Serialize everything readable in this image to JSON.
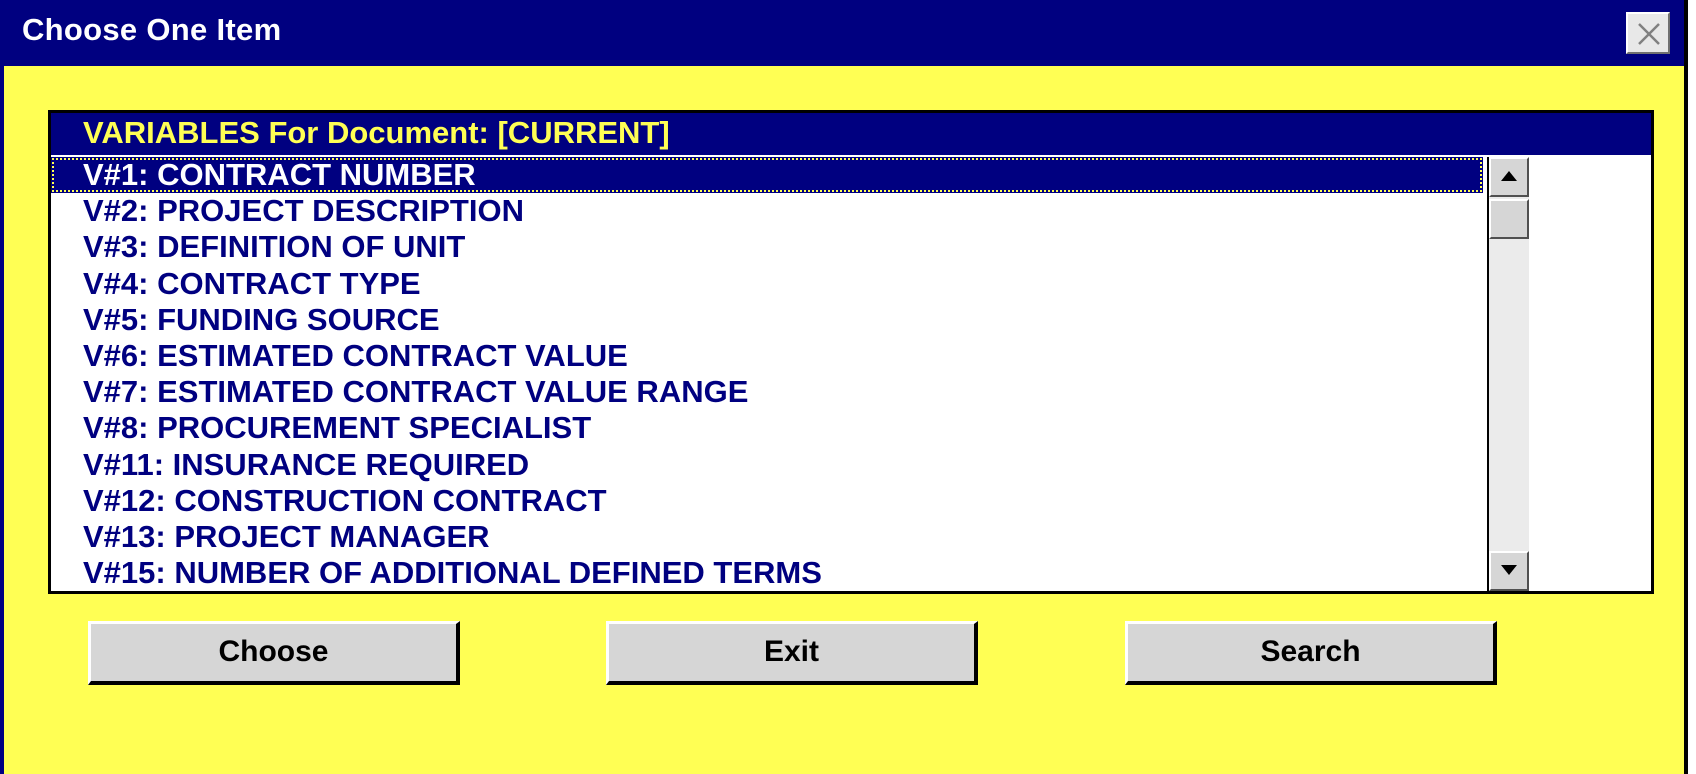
{
  "window": {
    "title": "Choose One Item"
  },
  "list": {
    "header": "VARIABLES For Document: [CURRENT]",
    "items": [
      "V#1: CONTRACT NUMBER",
      "V#2: PROJECT DESCRIPTION",
      "V#3: DEFINITION OF UNIT",
      "V#4: CONTRACT TYPE",
      "V#5: FUNDING SOURCE",
      "V#6: ESTIMATED CONTRACT VALUE",
      "V#7: ESTIMATED CONTRACT VALUE RANGE",
      "V#8: PROCUREMENT SPECIALIST",
      "V#11: INSURANCE REQUIRED",
      "V#12: CONSTRUCTION CONTRACT",
      "V#13: PROJECT MANAGER",
      "V#15: NUMBER OF ADDITIONAL DEFINED TERMS"
    ],
    "selected_index": 0
  },
  "buttons": {
    "choose": "Choose",
    "exit": "Exit",
    "search": "Search"
  },
  "icons": {
    "close": "close-icon",
    "scroll_up": "arrow-up-icon",
    "scroll_down": "arrow-down-icon"
  },
  "colors": {
    "title_bar": "#000080",
    "background": "#ffff54",
    "header_text": "#ffff54",
    "item_text": "#000080"
  }
}
